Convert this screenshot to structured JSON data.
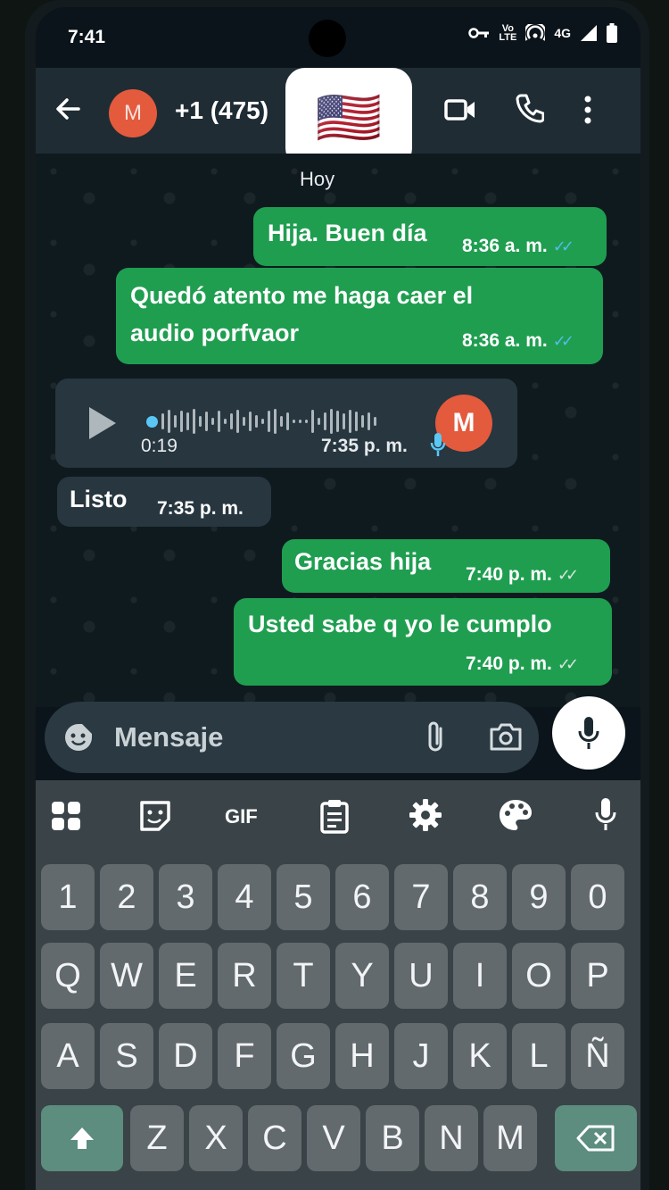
{
  "status_bar": {
    "time": "7:41",
    "volte": "Vo",
    "lte": "LTE",
    "network": "4G"
  },
  "header": {
    "avatar_letter": "M",
    "contact": "+1 (475)",
    "flag_emoji": "🇺🇸"
  },
  "chat": {
    "day_label": "Hoy",
    "messages": [
      {
        "direction": "out",
        "text": "Hija. Buen día",
        "time": "8:36 a. m.",
        "status": "read"
      },
      {
        "direction": "out",
        "text_lines": [
          "Quedó atento  me haga caer el",
          "audio porfvaor"
        ],
        "time": "8:36 a. m.",
        "status": "read"
      },
      {
        "direction": "in",
        "type": "voice",
        "duration": "0:19",
        "time": "7:35 p. m.",
        "avatar_letter": "M"
      },
      {
        "direction": "in",
        "text": "Listo",
        "time": "7:35 p. m."
      },
      {
        "direction": "out",
        "text": "Gracias hija",
        "time": "7:40 p. m.",
        "status": "delivered"
      },
      {
        "direction": "out",
        "text": "Usted sabe q yo le cumplo",
        "time": "7:40 p. m.",
        "status": "delivered"
      }
    ]
  },
  "composer": {
    "placeholder": "Mensaje"
  },
  "keyboard": {
    "toolbar_gif": "GIF",
    "rows": [
      [
        "1",
        "2",
        "3",
        "4",
        "5",
        "6",
        "7",
        "8",
        "9",
        "0"
      ],
      [
        "Q",
        "W",
        "E",
        "R",
        "T",
        "Y",
        "U",
        "I",
        "O",
        "P"
      ],
      [
        "A",
        "S",
        "D",
        "F",
        "G",
        "H",
        "J",
        "K",
        "L",
        "Ñ"
      ],
      [
        "Z",
        "X",
        "C",
        "V",
        "B",
        "N",
        "M"
      ]
    ]
  },
  "colors": {
    "outgoing_bubble": "#1f9e50",
    "incoming_bubble": "#27363f",
    "appbar": "#1f2c34",
    "avatar": "#e35a3d",
    "read_ticks": "#53bdeb",
    "shift_key": "#5c8d7f"
  }
}
